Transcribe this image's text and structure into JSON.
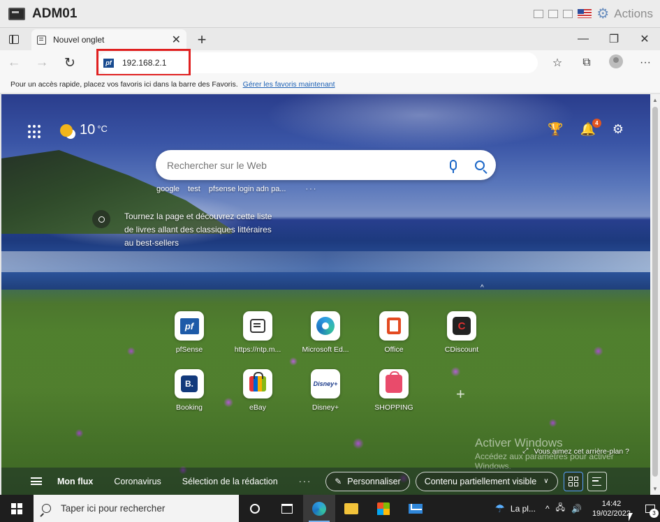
{
  "vm": {
    "title": "ADM01",
    "actions_label": "Actions",
    "icons": [
      "window-icon",
      "gear-icon",
      "us-flag-icon"
    ]
  },
  "browser": {
    "tab": {
      "title": "Nouvel onglet",
      "close": "✕"
    },
    "new_tab": "+",
    "window_controls": {
      "minimize": "—",
      "restore": "❐",
      "close": "✕"
    },
    "toolbar": {
      "back": "←",
      "forward": "→",
      "reload": "↻",
      "address": "192.168.2.1",
      "address_favicon": "pf",
      "favorites": "☆",
      "collections": "⧉",
      "more": "···"
    },
    "favbar": {
      "text": "Pour un accès rapide, placez vos favoris ici dans la barre des Favoris.",
      "link": "Gérer les favoris maintenant"
    }
  },
  "ntp": {
    "weather": {
      "temp": "10",
      "unit": "°C"
    },
    "top_icons": {
      "rewards": "🏆",
      "notifications_badge": "4",
      "settings": "⚙"
    },
    "search": {
      "placeholder": "Rechercher sur le Web"
    },
    "quick_searches": [
      "google",
      "test",
      "pfsense login adn pa..."
    ],
    "quick_searches_more": "···",
    "story": {
      "line1": "Tournez la page et découvrez cette liste",
      "line2": "de livres allant des classiques littéraires",
      "line3": "au best-sellers"
    },
    "tiles": [
      {
        "label": "pfSense",
        "glyph": "pf"
      },
      {
        "label": "https://ntp.m...",
        "glyph": ""
      },
      {
        "label": "Microsoft Ed...",
        "glyph": ""
      },
      {
        "label": "Office",
        "glyph": ""
      },
      {
        "label": "CDiscount",
        "glyph": "C"
      },
      {
        "label": "Booking",
        "glyph": "B."
      },
      {
        "label": "eBay",
        "glyph": ""
      },
      {
        "label": "Disney+",
        "glyph": "Disney+"
      },
      {
        "label": "SHOPPING",
        "glyph": ""
      }
    ],
    "add_tile": "+",
    "activate": {
      "title": "Activer Windows",
      "sub1": "Accédez aux paramètres pour activer",
      "sub2": "Windows."
    },
    "bg_question": "Vous aimez cet arrière-plan ?",
    "feed": {
      "tabs": [
        "Mon flux",
        "Coronavirus",
        "Sélection de la rédaction"
      ],
      "more": "···",
      "personalize": "Personnaliser",
      "visibility": "Contenu partiellement visible"
    }
  },
  "taskbar": {
    "search_placeholder": "Taper ici pour rechercher",
    "weather_text": "La pl...",
    "tray_icons": [
      "^",
      "🖧",
      "🔊"
    ],
    "time": "14:42",
    "date": "19/02/2022",
    "notifications_count": "3"
  }
}
